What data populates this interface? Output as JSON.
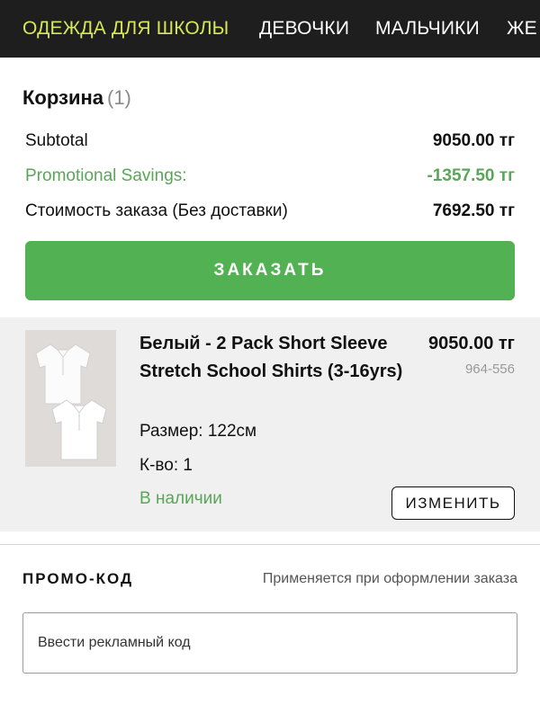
{
  "nav": {
    "items": [
      {
        "label": "ОДЕЖДА ДЛЯ ШКОЛЫ"
      },
      {
        "label": "ДЕВОЧКИ"
      },
      {
        "label": "МАЛЬЧИКИ"
      },
      {
        "label": "ЖЕ"
      }
    ]
  },
  "cart": {
    "title": "Корзина",
    "count": "(1)"
  },
  "summary": {
    "subtotal_label": "Subtotal",
    "subtotal_value": "9050.00 тг",
    "promo_label": "Promotional Savings:",
    "promo_value": "-1357.50 тг",
    "total_label": "Стоимость заказа (Без доставки)",
    "total_value": "7692.50 тг"
  },
  "actions": {
    "order_label": "ЗАКАЗАТЬ",
    "edit_label": "ИЗМЕНИТЬ"
  },
  "item": {
    "name": "Белый - 2 Pack Short Sleeve Stretch School Shirts (3-16yrs)",
    "price": "9050.00 тг",
    "sku": "964-556",
    "size": "Размер: 122см",
    "qty": "К-во: 1",
    "stock": "В наличии",
    "image_icon": "white-shirts-product-image"
  },
  "promo": {
    "title": "ПРОМО-КОД",
    "note": "Применяется при оформлении заказа",
    "placeholder": "Ввести рекламный код"
  },
  "colors": {
    "nav_bg": "#1e1e1e",
    "nav_active": "#d6e85a",
    "accent_green": "#52b152",
    "promo_green": "#5aa659",
    "item_bg": "#f0f0f0"
  }
}
